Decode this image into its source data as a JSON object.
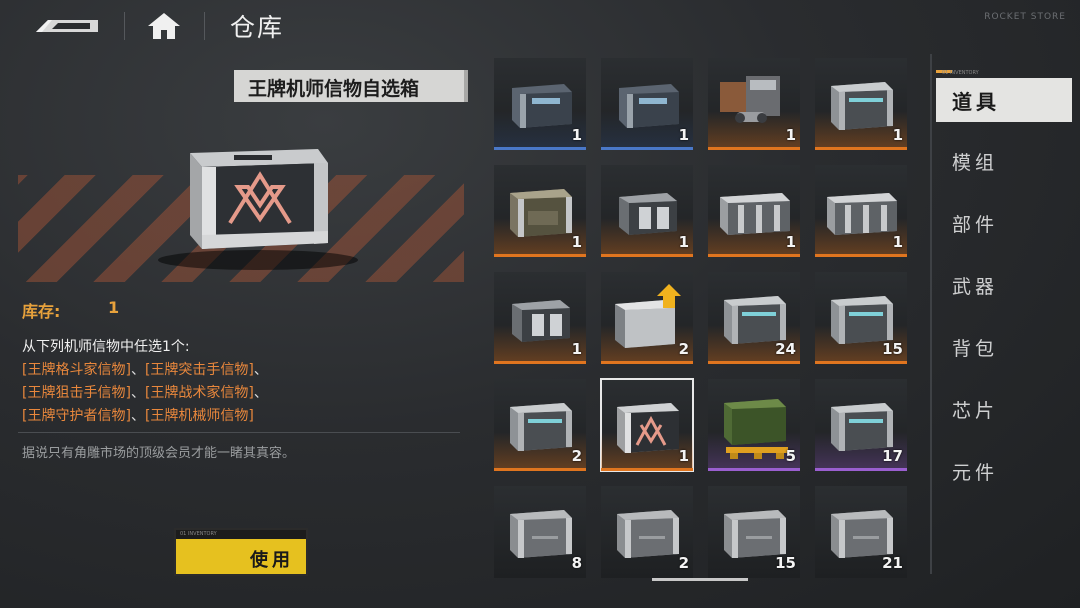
{
  "header": {
    "title": "仓库",
    "back_icon": "back-arrow-icon",
    "home_icon": "home-icon",
    "watermark": "ROCKET STORE"
  },
  "item": {
    "name": "王牌机师信物自选箱",
    "stock_label": "库存:",
    "stock_value": "1",
    "desc_intro": "从下列机师信物中任选1个:",
    "options": [
      "[王牌格斗家信物]",
      "[王牌突击手信物]",
      "[王牌狙击手信物]",
      "[王牌战术家信物]",
      "[王牌守护者信物]",
      "[王牌机械师信物]"
    ],
    "separator": "、",
    "flavor": "据说只有角雕市场的顶级会员才能一睹其真容。",
    "use_label": "使用"
  },
  "colors": {
    "blue": "#4a78c8",
    "orange": "#e0751f",
    "purple": "#9a5fd0",
    "accent": "#e8a23c",
    "button": "#e6c11f"
  },
  "inventory": [
    {
      "count": "1",
      "rarity": "blue",
      "icon": "crate-dark-icon"
    },
    {
      "count": "1",
      "rarity": "blue",
      "icon": "crate-dark-icon"
    },
    {
      "count": "1",
      "rarity": "orange",
      "icon": "minigun-icon"
    },
    {
      "count": "1",
      "rarity": "orange",
      "icon": "crate-metal-icon"
    },
    {
      "count": "1",
      "rarity": "orange",
      "icon": "crate-camo-icon"
    },
    {
      "count": "1",
      "rarity": "orange",
      "icon": "crate-tech-icon"
    },
    {
      "count": "1",
      "rarity": "orange",
      "icon": "crate-long-icon"
    },
    {
      "count": "1",
      "rarity": "orange",
      "icon": "crate-long-icon"
    },
    {
      "count": "1",
      "rarity": "orange",
      "icon": "crate-tech-icon"
    },
    {
      "count": "2",
      "rarity": "orange",
      "icon": "crate-upgrade-icon"
    },
    {
      "count": "24",
      "rarity": "orange",
      "icon": "crate-metal-icon"
    },
    {
      "count": "15",
      "rarity": "orange",
      "icon": "crate-metal-icon"
    },
    {
      "count": "2",
      "rarity": "orange",
      "icon": "crate-metal-icon"
    },
    {
      "count": "1",
      "rarity": "orange",
      "icon": "crate-ace-icon",
      "selected": true
    },
    {
      "count": "5",
      "rarity": "purple",
      "icon": "crate-green-pallet-icon"
    },
    {
      "count": "17",
      "rarity": "purple",
      "icon": "crate-metal-icon"
    },
    {
      "count": "8",
      "rarity": "none",
      "icon": "crate-grey-icon"
    },
    {
      "count": "2",
      "rarity": "none",
      "icon": "crate-grey-icon"
    },
    {
      "count": "15",
      "rarity": "none",
      "icon": "crate-grey-icon"
    },
    {
      "count": "21",
      "rarity": "none",
      "icon": "crate-grey-icon"
    }
  ],
  "categories": [
    "道具",
    "模组",
    "部件",
    "武器",
    "背包",
    "芯片",
    "元件"
  ],
  "active_category": "道具",
  "active_tag": "01 INVENTORY",
  "use_tag": "01 INVENTORY"
}
